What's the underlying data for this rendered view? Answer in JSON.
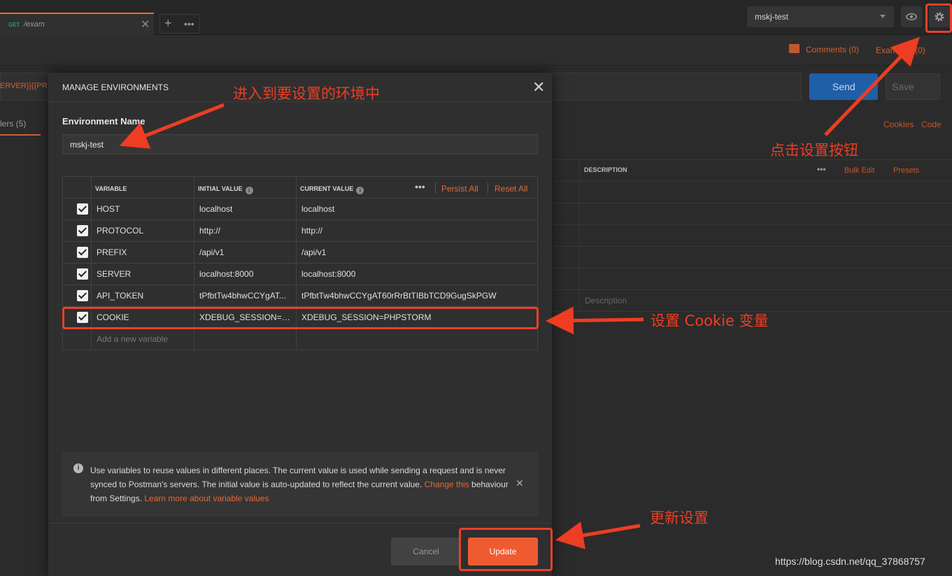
{
  "tab": {
    "method": "GET",
    "path": "/exam",
    "close": "✕"
  },
  "env_selector": {
    "value": "mskj-test"
  },
  "header_links": {
    "comments": "Comments (0)",
    "examples": "Examples (0)"
  },
  "request": {
    "url_fragment": "ERVER}}{{PR",
    "send_label": "Send",
    "save_label": "Save"
  },
  "subtabs": {
    "headers": "lers (5)",
    "cookies": "Cookies",
    "code": "Code"
  },
  "params_table": {
    "description_header": "DESCRIPTION",
    "bulk_edit": "Bulk Edit",
    "presets": "Presets",
    "description_placeholder": "Description"
  },
  "modal": {
    "title": "MANAGE ENVIRONMENTS",
    "env_name_label": "Environment Name",
    "env_name_value": "mskj-test",
    "columns": {
      "variable": "VARIABLE",
      "initial": "INITIAL VALUE",
      "current": "CURRENT VALUE"
    },
    "persist_all": "Persist All",
    "reset_all": "Reset All",
    "rows": [
      {
        "key": "HOST",
        "initial": "localhost",
        "current": "localhost",
        "checked": true
      },
      {
        "key": "PROTOCOL",
        "initial": "http://",
        "current": "http://",
        "checked": true
      },
      {
        "key": "PREFIX",
        "initial": "/api/v1",
        "current": "/api/v1",
        "checked": true
      },
      {
        "key": "SERVER",
        "initial": "localhost:8000",
        "current": "localhost:8000",
        "checked": true
      },
      {
        "key": "API_TOKEN",
        "initial": "tPfbtTw4bhwCCYgAT...",
        "current": "tPfbtTw4bhwCCYgAT60rRrBtTIBbTCD9GugSkPGW",
        "checked": true
      },
      {
        "key": "COOKIE",
        "initial": "XDEBUG_SESSION=P...",
        "current": "XDEBUG_SESSION=PHPSTORM",
        "checked": true
      }
    ],
    "add_variable_placeholder": "Add a new variable",
    "info": {
      "text1": "Use variables to reuse values in different places. The current value is used while sending a request and is never synced to Postman's servers. The initial value is auto-updated to reflect the current value. ",
      "link1": "Change this",
      "text2": " behaviour from Settings. ",
      "link2": "Learn more about variable values"
    },
    "cancel_label": "Cancel",
    "update_label": "Update"
  },
  "annotations": {
    "enter_env": "进入到要设置的环境中",
    "click_settings": "点击设置按钮",
    "set_cookie": "设置 Cookie 变量",
    "update_settings": "更新设置"
  },
  "watermark": "https://blog.csdn.net/qq_37868757",
  "colors": {
    "accent": "#ef5b31",
    "annotation_red": "#e8412a",
    "send_blue": "#1f5fa8"
  }
}
